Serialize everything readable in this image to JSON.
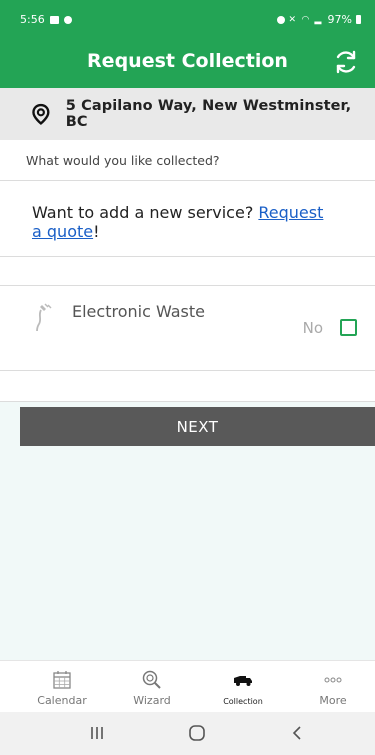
{
  "status_bar": {
    "time": "5:56",
    "battery": "97%"
  },
  "header": {
    "title": "Request Collection"
  },
  "address": {
    "text": "5 Capilano Way, New Westminster, BC"
  },
  "question": "What would you like collected?",
  "quote": {
    "prefix": "Want to add a new service? ",
    "link": "Request a quote",
    "suffix": "!"
  },
  "service": {
    "label": "Electronic Waste",
    "toggle_text": "No",
    "checked": false
  },
  "next_button": "NEXT",
  "tabs": [
    {
      "label": "Calendar",
      "icon": "calendar-icon"
    },
    {
      "label": "Wizard",
      "icon": "wizard-search-icon"
    },
    {
      "label": "Collection",
      "icon": "truck-icon"
    },
    {
      "label": "More",
      "icon": "more-dots-icon"
    }
  ],
  "colors": {
    "brand_green": "#23a455",
    "button_gray": "#595959",
    "link_blue": "#1a5fc7"
  }
}
